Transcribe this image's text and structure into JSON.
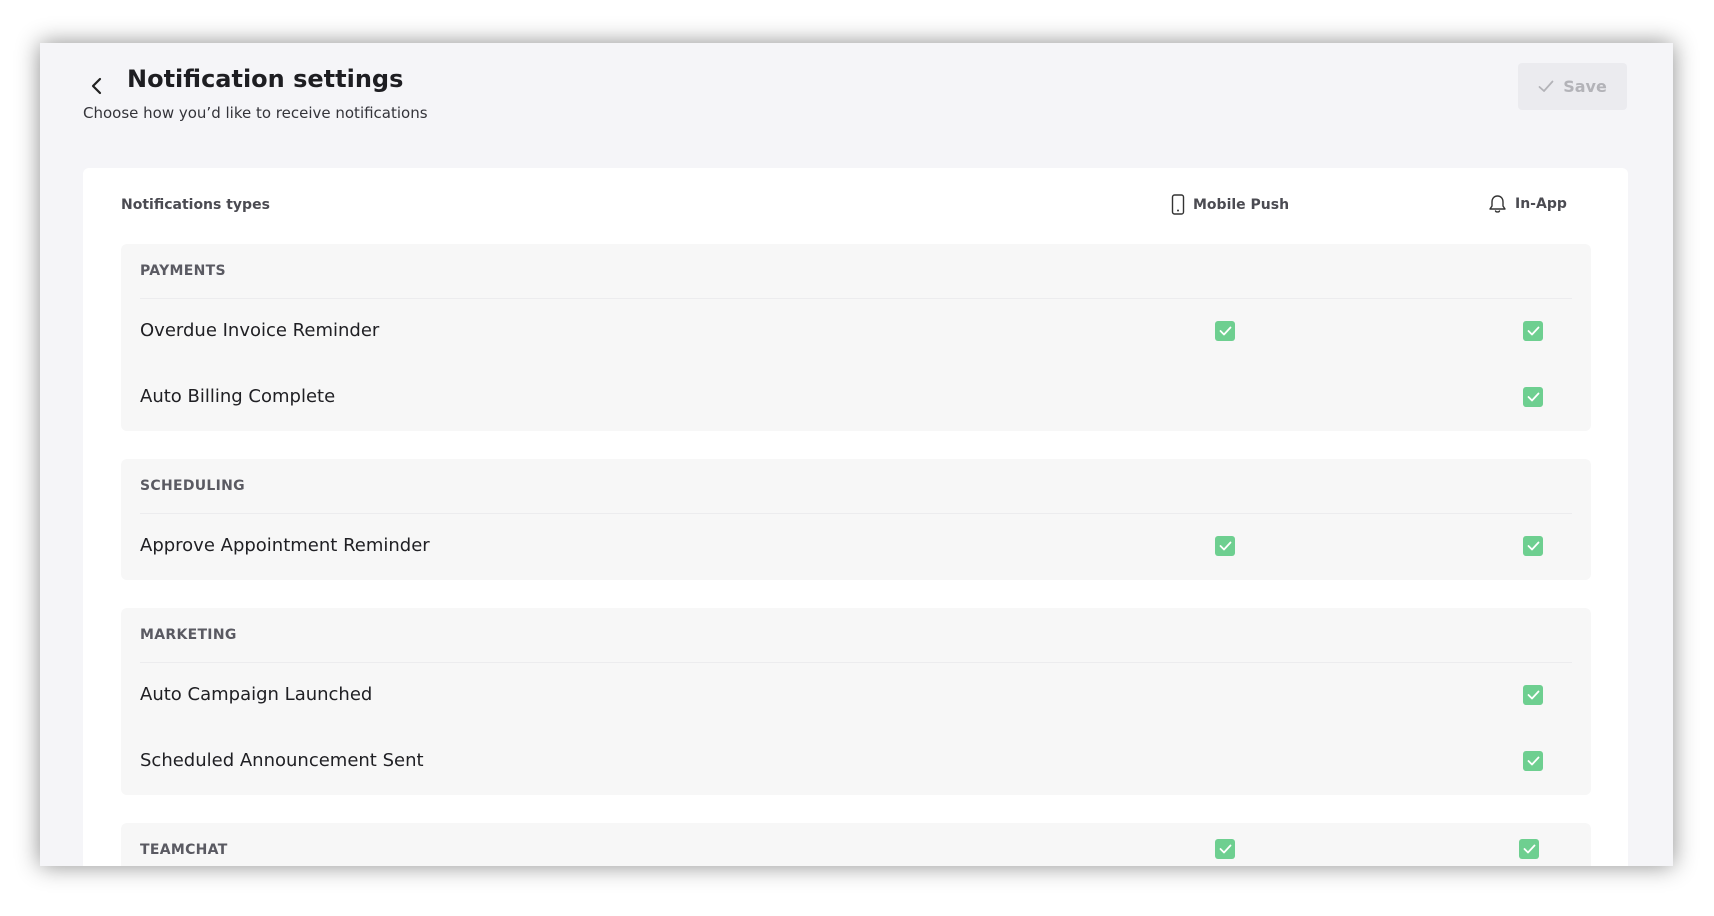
{
  "header": {
    "title": "Notification settings",
    "subtitle": "Choose how you’d like to receive notifications",
    "save_label": "Save",
    "back_icon": "chevron-left-icon",
    "save_icon": "check-icon"
  },
  "columns": {
    "types_label": "Notifications types",
    "mobile_label": "Mobile Push",
    "mobile_icon": "mobile-phone-icon",
    "inapp_label": "In-App",
    "inapp_icon": "bell-icon"
  },
  "colors": {
    "checkbox_checked": "#6ecf90",
    "save_disabled_text": "#b3b3b8"
  },
  "groups": [
    {
      "title": "PAYMENTS",
      "items": [
        {
          "label": "Overdue Invoice Reminder",
          "mobile_push": true,
          "in_app": true
        },
        {
          "label": "Auto Billing Complete",
          "mobile_push": false,
          "in_app": true
        }
      ]
    },
    {
      "title": "SCHEDULING",
      "items": [
        {
          "label": "Approve Appointment Reminder",
          "mobile_push": true,
          "in_app": true
        }
      ]
    },
    {
      "title": "MARKETING",
      "items": [
        {
          "label": "Auto Campaign Launched",
          "mobile_push": false,
          "in_app": true
        },
        {
          "label": "Scheduled Announcement Sent",
          "mobile_push": false,
          "in_app": true
        }
      ]
    },
    {
      "title": "TEAMCHAT",
      "mobile_push": true,
      "in_app": true,
      "items": []
    }
  ]
}
